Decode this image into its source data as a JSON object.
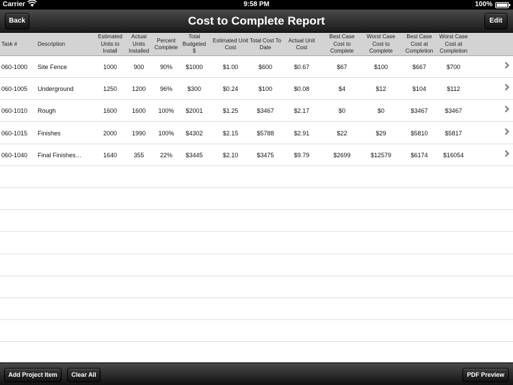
{
  "status_bar": {
    "carrier": "Carrier",
    "time": "9:58 PM",
    "battery": "100%"
  },
  "navbar": {
    "title": "Cost to Complete Report",
    "back_label": "Back",
    "edit_label": "Edit"
  },
  "table": {
    "columns": [
      "Task #",
      "Description",
      "Estimated Units to Install",
      "Actual Units Installed",
      "Percent Complete",
      "Total Budgeted $",
      "Estimated Unit Cost",
      "Total Cost To Date",
      "Actual Unit Cost",
      "Best Case Cost to Complete",
      "Worst Case Cost to Complete",
      "Best Case Cost at Completion",
      "Worst Case Cost at Completion"
    ],
    "rows": [
      [
        "060-1000",
        "Site Fence",
        "1000",
        "900",
        "90%",
        "$1000",
        "$1.00",
        "$600",
        "$0.67",
        "$67",
        "$100",
        "$667",
        "$700"
      ],
      [
        "060-1005",
        "Underground",
        "1250",
        "1200",
        "96%",
        "$300",
        "$0.24",
        "$100",
        "$0.08",
        "$4",
        "$12",
        "$104",
        "$112"
      ],
      [
        "060-1010",
        "Rough",
        "1600",
        "1600",
        "100%",
        "$2001",
        "$1.25",
        "$3467",
        "$2.17",
        "$0",
        "$0",
        "$3467",
        "$3467"
      ],
      [
        "060-1015",
        "Finishes",
        "2000",
        "1990",
        "100%",
        "$4302",
        "$2.15",
        "$5788",
        "$2.91",
        "$22",
        "$29",
        "$5810",
        "$5817"
      ],
      [
        "060-1040",
        "Final Finishes…",
        "1640",
        "355",
        "22%",
        "$3445",
        "$2.10",
        "$3475",
        "$9.79",
        "$2699",
        "$12579",
        "$6174",
        "$16054"
      ]
    ]
  },
  "toolbar": {
    "add_label": "Add Project Item",
    "clear_label": "Clear All",
    "pdf_label": "PDF Preview"
  }
}
